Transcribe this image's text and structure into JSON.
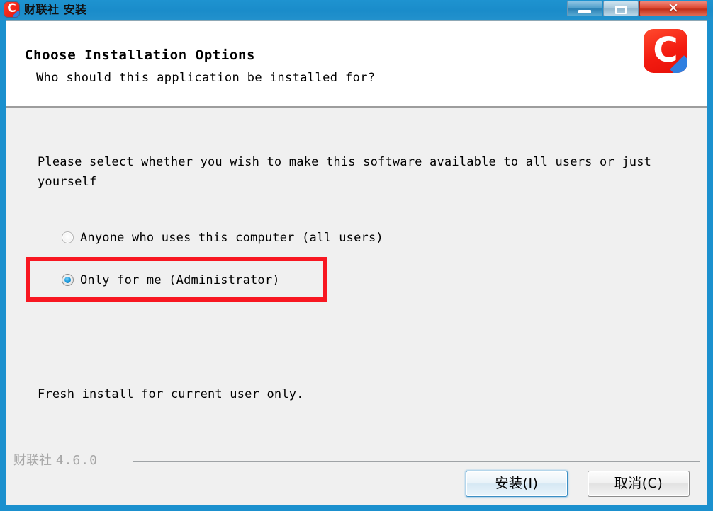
{
  "window": {
    "title": "财联社 安装",
    "icon": "app-logo-c-icon",
    "controls": {
      "minimize": "minimize-icon",
      "maximize": "maximize-icon",
      "close": "✕"
    }
  },
  "header": {
    "title": "Choose Installation Options",
    "subtitle": "Who should this application be installed for?",
    "logo": "C"
  },
  "body": {
    "intro": "Please select whether you wish to make this software available to all users or just yourself",
    "options": [
      {
        "label": "Anyone who uses this computer (all users)",
        "selected": false
      },
      {
        "label": "Only for me (Administrator)",
        "selected": true
      }
    ],
    "status": "Fresh install for current user only."
  },
  "footer": {
    "brand_name": "财联社",
    "version": "4.6.0",
    "install_label": "安装(I)",
    "cancel_label": "取消(C)"
  },
  "annotation": {
    "highlight_color": "#f81721",
    "target": "Only for me (Administrator)"
  }
}
